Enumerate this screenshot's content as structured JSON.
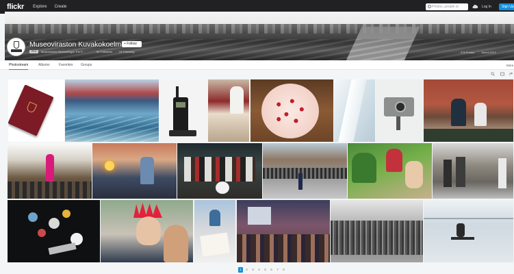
{
  "topnav": {
    "logo": "flickr",
    "links": [
      "Explore",
      "Create"
    ],
    "search_placeholder": "Photos, people or groups",
    "signin": "Log In",
    "signup": "Sign Up"
  },
  "profile": {
    "name": "Museoviraston Kuvakokoelmat",
    "follow_label": "+ Follow",
    "badge": "PRO",
    "subtitle": "Museovirasto Bildsamlingar The P...",
    "followers": "5K Followers",
    "following": "24 Following",
    "photos_count": "978 Photos",
    "joined": "Joined 2012"
  },
  "tabs": [
    "Photostream",
    "Albums",
    "Favorites",
    "Groups"
  ],
  "more_label": "More",
  "pagination": {
    "pages": [
      "1",
      "2",
      "3",
      "4",
      "5",
      "6",
      "7",
      "8"
    ],
    "current": "1"
  },
  "icons": {
    "search": "search-icon",
    "upload": "cloud-upload-icon",
    "slideshow": "slideshow-icon",
    "share": "share-icon",
    "zoom": "magnifier-icon"
  },
  "colors": {
    "nav_bg": "#212124",
    "accent": "#128fdc",
    "page_bg": "#f3f5f6"
  }
}
